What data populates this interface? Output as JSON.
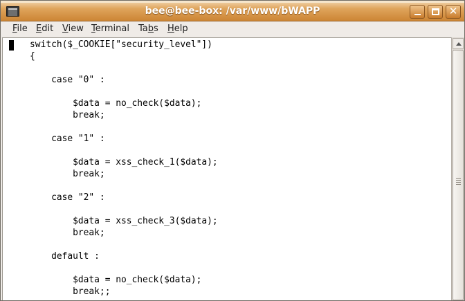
{
  "window": {
    "title": "bee@bee-box: /var/www/bWAPP"
  },
  "menu": [
    {
      "mnemonic": "F",
      "rest": "ile"
    },
    {
      "mnemonic": "E",
      "rest": "dit"
    },
    {
      "mnemonic": "V",
      "rest": "iew"
    },
    {
      "mnemonic": "T",
      "rest": "erminal"
    },
    {
      "pre": "Ta",
      "mnemonic": "b",
      "rest": "s"
    },
    {
      "mnemonic": "H",
      "rest": "elp"
    }
  ],
  "code": [
    "    switch($_COOKIE[\"security_level\"])",
    "    {",
    "",
    "        case \"0\" :",
    "",
    "            $data = no_check($data);",
    "            break;",
    "",
    "        case \"1\" :",
    "",
    "            $data = xss_check_1($data);",
    "            break;",
    "",
    "        case \"2\" :",
    "",
    "            $data = xss_check_3($data);",
    "            break;",
    "",
    "        default :",
    "",
    "            $data = no_check($data);",
    "            break;;"
  ],
  "colors": {
    "title_gradient_top": "#dfa45b",
    "title_gradient_bottom": "#cc8535",
    "terminal_bg": "#ffffff",
    "terminal_fg": "#000000"
  },
  "icons": [
    "terminal-app-icon",
    "minimize-icon",
    "maximize-icon",
    "close-icon",
    "scroll-up-arrow-icon"
  ]
}
